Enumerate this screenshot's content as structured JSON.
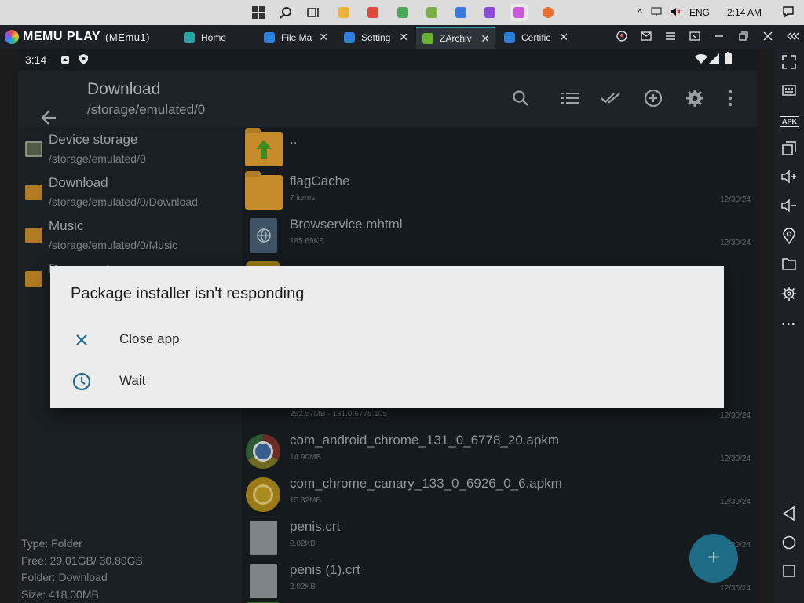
{
  "taskbar": {
    "tray": {
      "chevron": "^",
      "language": "ENG",
      "time": "2:14 AM"
    },
    "icons": [
      "windows-start-icon",
      "search-icon",
      "task-view-icon",
      "file-explorer-icon",
      "app-icon",
      "app-icon",
      "app-icon",
      "app-icon",
      "app-icon",
      "app-icon",
      "firefox-icon"
    ]
  },
  "memu": {
    "logo_text": "MEMU PLAY",
    "instance": "(MEmu1)",
    "tabs": [
      {
        "label": "Home",
        "color": "#2aa3a0"
      },
      {
        "label": "File Ma",
        "color": "#2f7fd8"
      },
      {
        "label": "Setting",
        "color": "#2f7fd8"
      },
      {
        "label": "ZArchiv",
        "color": "#6ab233"
      },
      {
        "label": "Certific",
        "color": "#2f7fd8"
      }
    ],
    "close_glyph": "✕",
    "window_controls": [
      "user-icon",
      "mail-icon",
      "menu-icon",
      "resize-icon",
      "minimize-icon",
      "maximize-icon",
      "close-icon",
      "collapse-icon"
    ]
  },
  "android": {
    "status": {
      "time": "3:14"
    },
    "appbar": {
      "title": "Download",
      "subtitle": "/storage/emulated/0"
    },
    "locations": [
      {
        "name": "Device storage",
        "path": "/storage/emulated/0",
        "color": "#5d7a4a"
      },
      {
        "name": "Download",
        "path": "/storage/emulated/0/Download",
        "color": "#b27a23"
      },
      {
        "name": "Music",
        "path": "/storage/emulated/0/Music",
        "color": "#b27a23"
      },
      {
        "name": "Documents",
        "path": "",
        "color": "#b27a23"
      }
    ],
    "info": {
      "type": "Type: Folder",
      "free": "Free: 29.01GB/ 30.80GB",
      "folder": "Folder: Download",
      "size": "Size: 418.00MB"
    },
    "files": [
      {
        "name": "..",
        "meta": "",
        "date": "",
        "icon": "folder-up"
      },
      {
        "name": "flagCache",
        "meta": "7 items",
        "date": "12/30/24",
        "icon": "folder"
      },
      {
        "name": "Browservice.mhtml",
        "meta": "185.69KB",
        "date": "12/30/24",
        "icon": "web-doc"
      },
      {
        "name": "",
        "meta": "252.57MB  ·  131.0.6778.105",
        "date": "12/30/24",
        "icon": "chrome"
      },
      {
        "name": "com_android_chrome_131_0_6778_20.apkm",
        "meta": "14.90MB",
        "date": "12/30/24",
        "icon": "chrome"
      },
      {
        "name": "com_chrome_canary_133_0_6926_0_6.apkm",
        "meta": "15.82MB",
        "date": "12/30/24",
        "icon": "canary"
      },
      {
        "name": "penis.crt",
        "meta": "2.02KB",
        "date": "12/30/24",
        "icon": "doc"
      },
      {
        "name": "penis (1).crt",
        "meta": "2.02KB",
        "date": "12/30/24",
        "icon": "doc"
      }
    ],
    "fab": "+"
  },
  "dialog": {
    "title": "Package installer isn't responding",
    "options": [
      {
        "label": "Close app",
        "icon": "close-icon"
      },
      {
        "label": "Wait",
        "icon": "clock-icon"
      }
    ]
  },
  "sidebar": {
    "buttons": [
      "fullscreen-icon",
      "keyboard-icon",
      "apk-icon",
      "multi-window-icon",
      "volume-up-icon",
      "volume-down-icon",
      "location-icon",
      "folder-icon",
      "settings-icon",
      "more-icon",
      "back-icon",
      "home-icon",
      "recents-icon"
    ],
    "apk_label": "APK",
    "more_glyph": "···"
  }
}
